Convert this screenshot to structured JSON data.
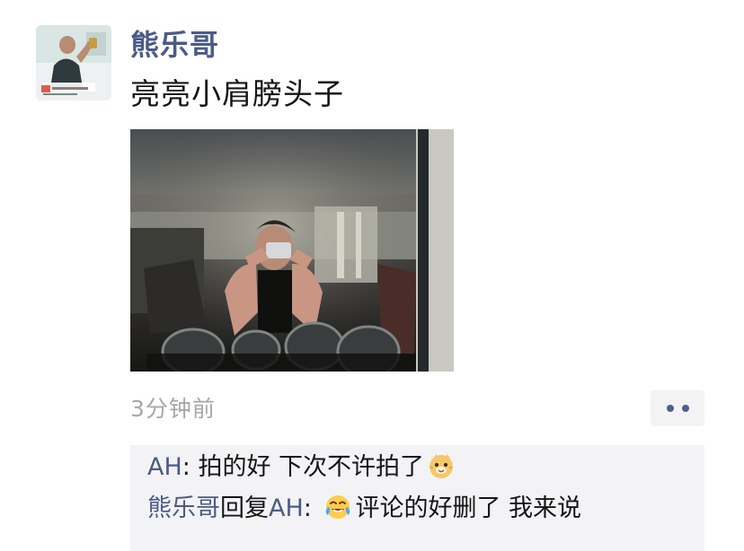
{
  "post": {
    "author_name": "熊乐哥",
    "text": "亮亮小肩膀头子",
    "time": "3分钟前",
    "avatar_icon": "profile-photo-avatar",
    "image_icon": "gym-mirror-selfie-photo",
    "more_icon": "more-actions-icon"
  },
  "comments": [
    {
      "author": "AH",
      "separator": ": ",
      "text": "拍的好 下次不许拍了",
      "emoji": "doge-emoji"
    },
    {
      "author": "熊乐哥",
      "reply_word": "回复",
      "reply_to": "AH",
      "separator": ": ",
      "emoji": "laughing-tears-emoji",
      "text": "评论的好删了 我来说"
    }
  ],
  "colors": {
    "name": "#4b5b86",
    "text": "#151515",
    "time": "#a7a7a7",
    "comment_bg": "#f3f3f5"
  }
}
